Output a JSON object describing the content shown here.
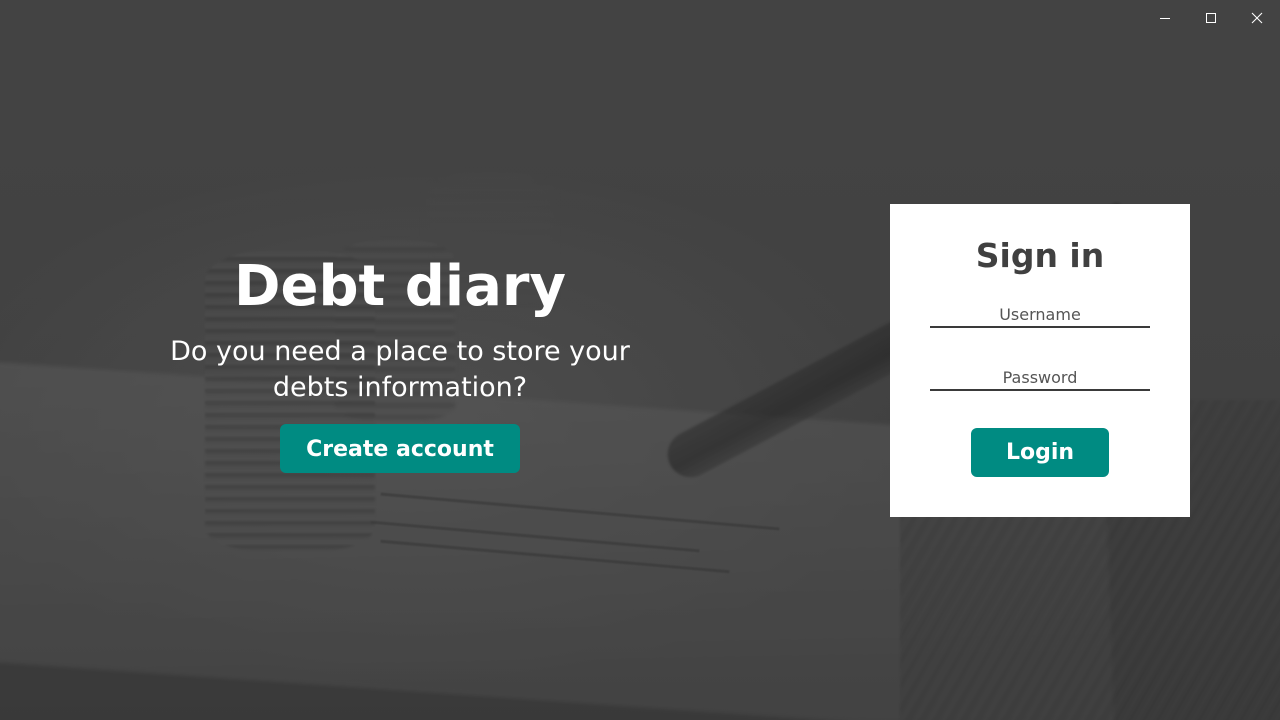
{
  "window": {
    "controls": {
      "minimize_icon": "minimize-icon",
      "maximize_icon": "maximize-icon",
      "close_icon": "close-icon"
    }
  },
  "hero": {
    "title": "Debt diary",
    "subtitle": "Do you need a place to store your debts information?",
    "create_account_label": "Create account"
  },
  "sign_in": {
    "title": "Sign in",
    "username": {
      "value": "",
      "placeholder": "Username"
    },
    "password": {
      "value": "",
      "placeholder": "Password"
    },
    "login_label": "Login"
  },
  "colors": {
    "accent": "#008b82",
    "background_overlay": "#4b4b4b",
    "card_background": "#ffffff",
    "card_title": "#404040",
    "text_light": "#ffffff"
  }
}
